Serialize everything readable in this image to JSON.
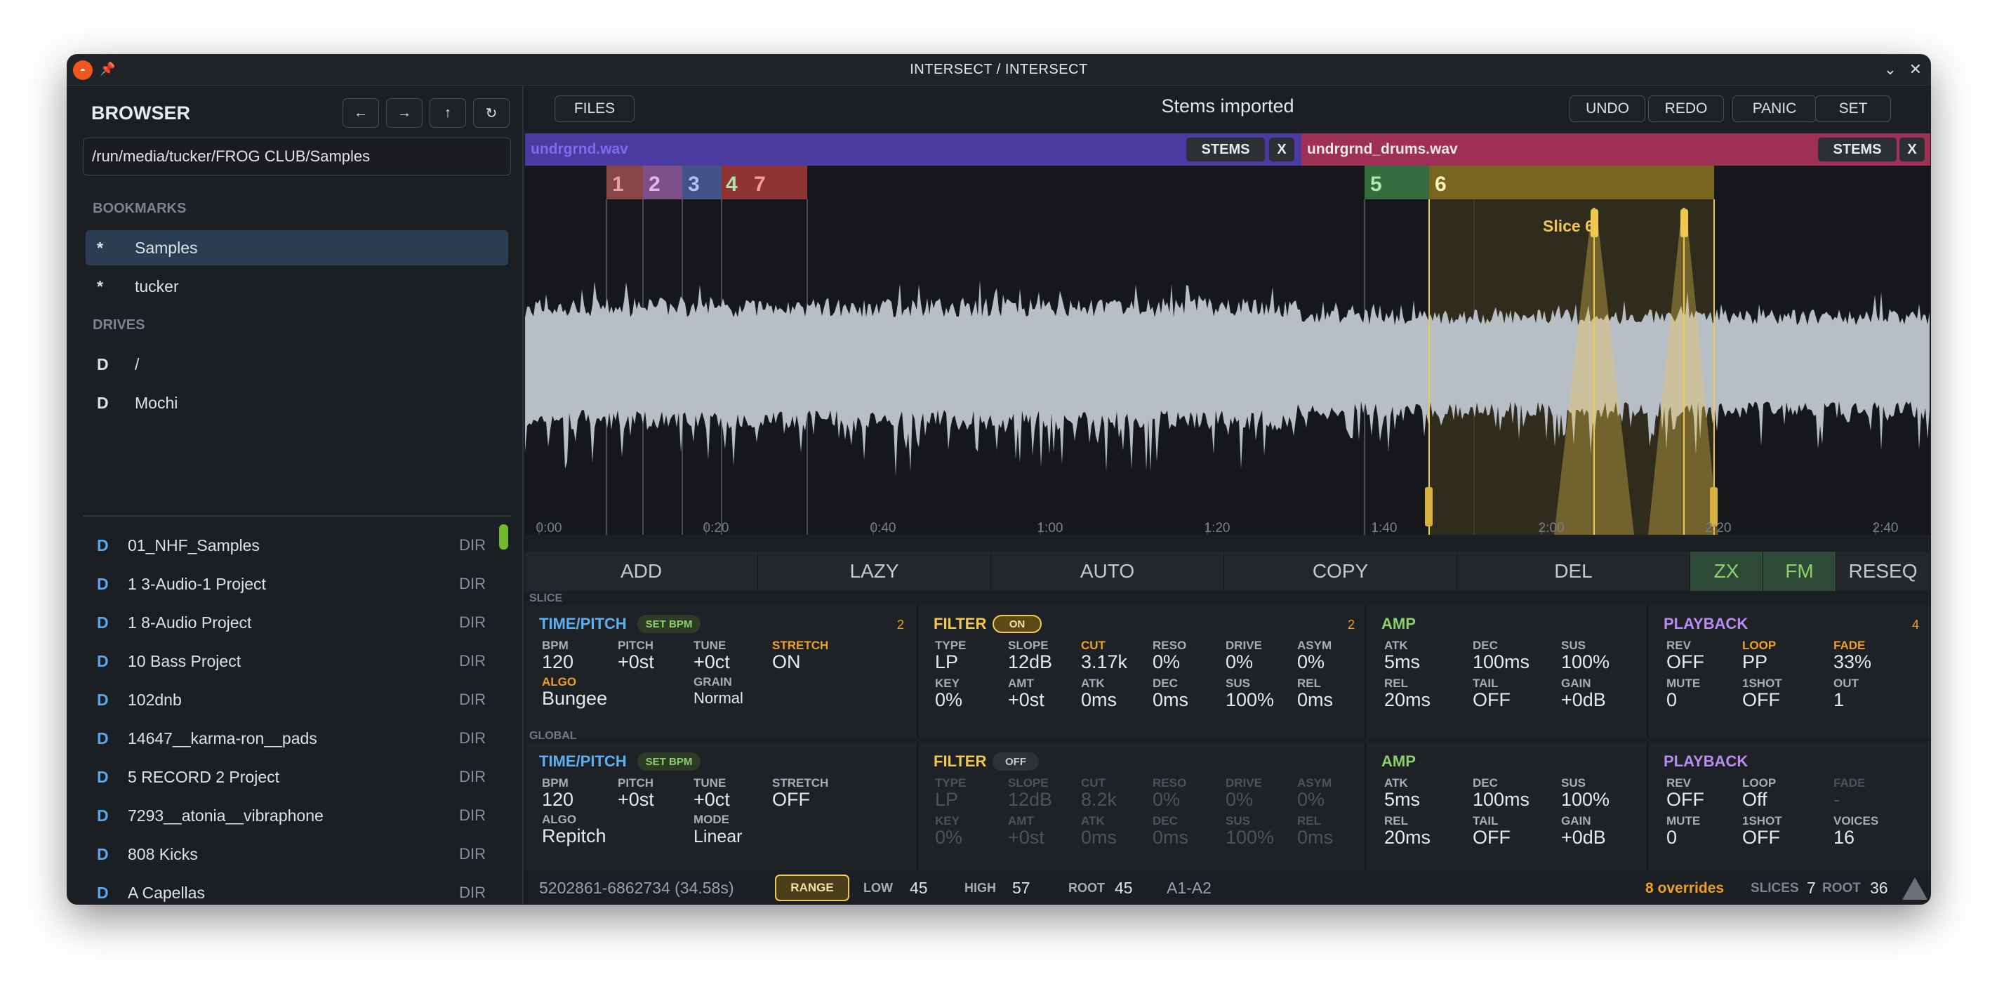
{
  "window": {
    "title": "INTERSECT / INTERSECT"
  },
  "browser": {
    "title": "BROWSER",
    "path": "/run/media/tucker/FROG CLUB/Samples",
    "bookmarks_label": "BOOKMARKS",
    "bookmarks": [
      {
        "mark": "*",
        "name": "Samples"
      },
      {
        "mark": "*",
        "name": "tucker"
      }
    ],
    "drives_label": "DRIVES",
    "drives": [
      {
        "mark": "D",
        "name": "/"
      },
      {
        "mark": "D",
        "name": "Mochi"
      }
    ],
    "files": [
      {
        "mark": "D",
        "name": "01_NHF_Samples",
        "type": "DIR"
      },
      {
        "mark": "D",
        "name": "1 3-Audio-1 Project",
        "type": "DIR"
      },
      {
        "mark": "D",
        "name": "1 8-Audio Project",
        "type": "DIR"
      },
      {
        "mark": "D",
        "name": "10 Bass Project",
        "type": "DIR"
      },
      {
        "mark": "D",
        "name": "102dnb",
        "type": "DIR"
      },
      {
        "mark": "D",
        "name": "14647__karma-ron__pads",
        "type": "DIR"
      },
      {
        "mark": "D",
        "name": "5 RECORD 2 Project",
        "type": "DIR"
      },
      {
        "mark": "D",
        "name": "7293__atonia__vibraphone",
        "type": "DIR"
      },
      {
        "mark": "D",
        "name": "808 Kicks",
        "type": "DIR"
      },
      {
        "mark": "D",
        "name": "A Capellas",
        "type": "DIR"
      }
    ]
  },
  "topbar": {
    "files": "FILES",
    "status": "Stems imported",
    "undo": "UNDO",
    "redo": "REDO",
    "panic": "PANIC",
    "set": "SET"
  },
  "tracks": [
    {
      "name": "undrgrnd.wav",
      "stems": "STEMS",
      "close": "X",
      "color": "#4b3aa0"
    },
    {
      "name": "undrgrnd_drums.wav",
      "stems": "STEMS",
      "close": "X",
      "color": "#9e2f55"
    }
  ],
  "slices": {
    "labels": [
      "1",
      "2",
      "3",
      "4",
      "7",
      "5",
      "6"
    ],
    "hover_label": "Slice 6"
  },
  "timeline": [
    "0:00",
    "0:20",
    "0:40",
    "1:00",
    "1:20",
    "1:40",
    "2:00",
    "2:20",
    "2:40"
  ],
  "toolbar": [
    "ADD",
    "LAZY",
    "AUTO",
    "COPY",
    "DEL",
    "ZX",
    "FM",
    "RESEQ"
  ],
  "slice_section": {
    "label": "SLICE",
    "time": {
      "title": "TIME/PITCH",
      "pill": "SET BPM",
      "count": "2",
      "bpm_l": "BPM",
      "bpm": "120",
      "pitch_l": "PITCH",
      "pitch": "+0st",
      "tune_l": "TUNE",
      "tune": "+0ct",
      "stretch_l": "STRETCH",
      "stretch": "ON",
      "algo_l": "ALGO",
      "algo": "Bungee",
      "grain_l": "GRAIN",
      "grain": "Normal"
    },
    "filter": {
      "title": "FILTER",
      "pill": "ON",
      "count": "2",
      "type_l": "TYPE",
      "type": "LP",
      "slope_l": "SLOPE",
      "slope": "12dB",
      "cut_l": "CUT",
      "cut": "3.17k",
      "reso_l": "RESO",
      "reso": "0%",
      "drive_l": "DRIVE",
      "drive": "0%",
      "asym_l": "ASYM",
      "asym": "0%",
      "key_l": "KEY",
      "key": "0%",
      "amt_l": "AMT",
      "amt": "+0st",
      "atk_l": "ATK",
      "atk": "0ms",
      "dec_l": "DEC",
      "dec": "0ms",
      "sus_l": "SUS",
      "sus": "100%",
      "rel_l": "REL",
      "rel": "0ms"
    },
    "amp": {
      "title": "AMP",
      "atk_l": "ATK",
      "atk": "5ms",
      "dec_l": "DEC",
      "dec": "100ms",
      "sus_l": "SUS",
      "sus": "100%",
      "rel_l": "REL",
      "rel": "20ms",
      "tail_l": "TAIL",
      "tail": "OFF",
      "gain_l": "GAIN",
      "gain": "+0dB"
    },
    "playback": {
      "title": "PLAYBACK",
      "count": "4",
      "rev_l": "REV",
      "rev": "OFF",
      "loop_l": "LOOP",
      "loop": "PP",
      "fade_l": "FADE",
      "fade": "33%",
      "mute_l": "MUTE",
      "mute": "0",
      "oneshot_l": "1SHOT",
      "oneshot": "OFF",
      "out_l": "OUT",
      "out": "1"
    }
  },
  "global_section": {
    "label": "GLOBAL",
    "time": {
      "title": "TIME/PITCH",
      "pill": "SET BPM",
      "bpm_l": "BPM",
      "bpm": "120",
      "pitch_l": "PITCH",
      "pitch": "+0st",
      "tune_l": "TUNE",
      "tune": "+0ct",
      "stretch_l": "STRETCH",
      "stretch": "OFF",
      "algo_l": "ALGO",
      "algo": "Repitch",
      "mode_l": "MODE",
      "mode": "Linear"
    },
    "filter": {
      "title": "FILTER",
      "pill": "OFF",
      "type_l": "TYPE",
      "type": "LP",
      "slope_l": "SLOPE",
      "slope": "12dB",
      "cut_l": "CUT",
      "cut": "8.2k",
      "reso_l": "RESO",
      "reso": "0%",
      "drive_l": "DRIVE",
      "drive": "0%",
      "asym_l": "ASYM",
      "asym": "0%",
      "key_l": "KEY",
      "key": "0%",
      "amt_l": "AMT",
      "amt": "+0st",
      "atk_l": "ATK",
      "atk": "0ms",
      "dec_l": "DEC",
      "dec": "0ms",
      "sus_l": "SUS",
      "sus": "100%",
      "rel_l": "REL",
      "rel": "0ms"
    },
    "amp": {
      "title": "AMP",
      "atk_l": "ATK",
      "atk": "5ms",
      "dec_l": "DEC",
      "dec": "100ms",
      "sus_l": "SUS",
      "sus": "100%",
      "rel_l": "REL",
      "rel": "20ms",
      "tail_l": "TAIL",
      "tail": "OFF",
      "gain_l": "GAIN",
      "gain": "+0dB"
    },
    "playback": {
      "title": "PLAYBACK",
      "rev_l": "REV",
      "rev": "OFF",
      "loop_l": "LOOP",
      "loop": "Off",
      "fade_l": "FADE",
      "fade": "-",
      "mute_l": "MUTE",
      "mute": "0",
      "oneshot_l": "1SHOT",
      "oneshot": "OFF",
      "voices_l": "VOICES",
      "voices": "16"
    }
  },
  "footer": {
    "range_text": "5202861-6862734 (34.58s)",
    "range_btn": "RANGE",
    "low_l": "LOW",
    "low": "45",
    "high_l": "HIGH",
    "high": "57",
    "root_l": "ROOT",
    "root": "45",
    "notes": "A1-A2",
    "overrides": "8 overrides",
    "slices_l": "SLICES",
    "slices": "7",
    "root2_l": "ROOT",
    "root2": "36"
  },
  "colors": {
    "accent": "#f0a020",
    "blue": "#5ab0f0",
    "green": "#8bd06a",
    "purple": "#b88cf0",
    "yellow": "#f0c850"
  }
}
